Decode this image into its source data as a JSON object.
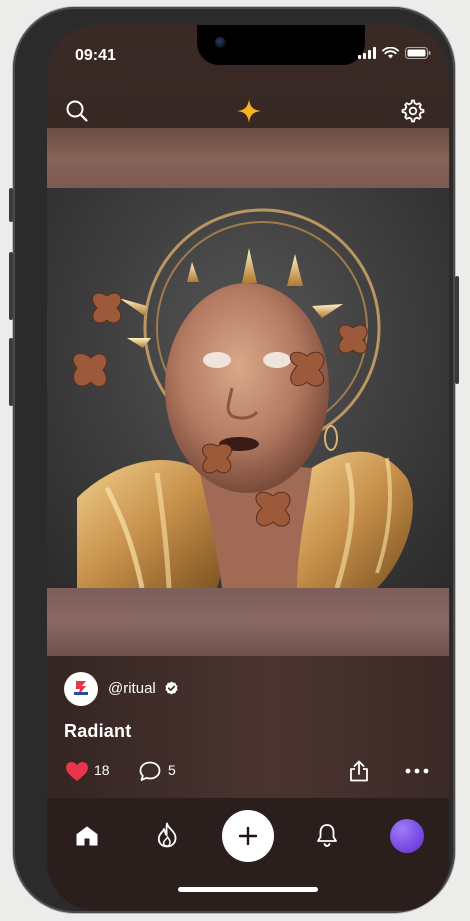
{
  "status": {
    "time": "09:41"
  },
  "header": {
    "search_icon": "search-icon",
    "logo_icon": "sparkle-icon",
    "logo_color": "#f5b324",
    "settings_icon": "gear-icon"
  },
  "post": {
    "image_subject": "golden-portrait-artwork",
    "author_handle": "@ritual",
    "verified": true,
    "title": "Radiant",
    "likes": "18",
    "comments": "5",
    "like_color": "#e8354b"
  },
  "tabbar": {
    "items": [
      "home-icon",
      "flame-icon",
      "plus-icon",
      "bell-icon",
      "profile-avatar"
    ],
    "avatar_color": "#7c4de6"
  }
}
